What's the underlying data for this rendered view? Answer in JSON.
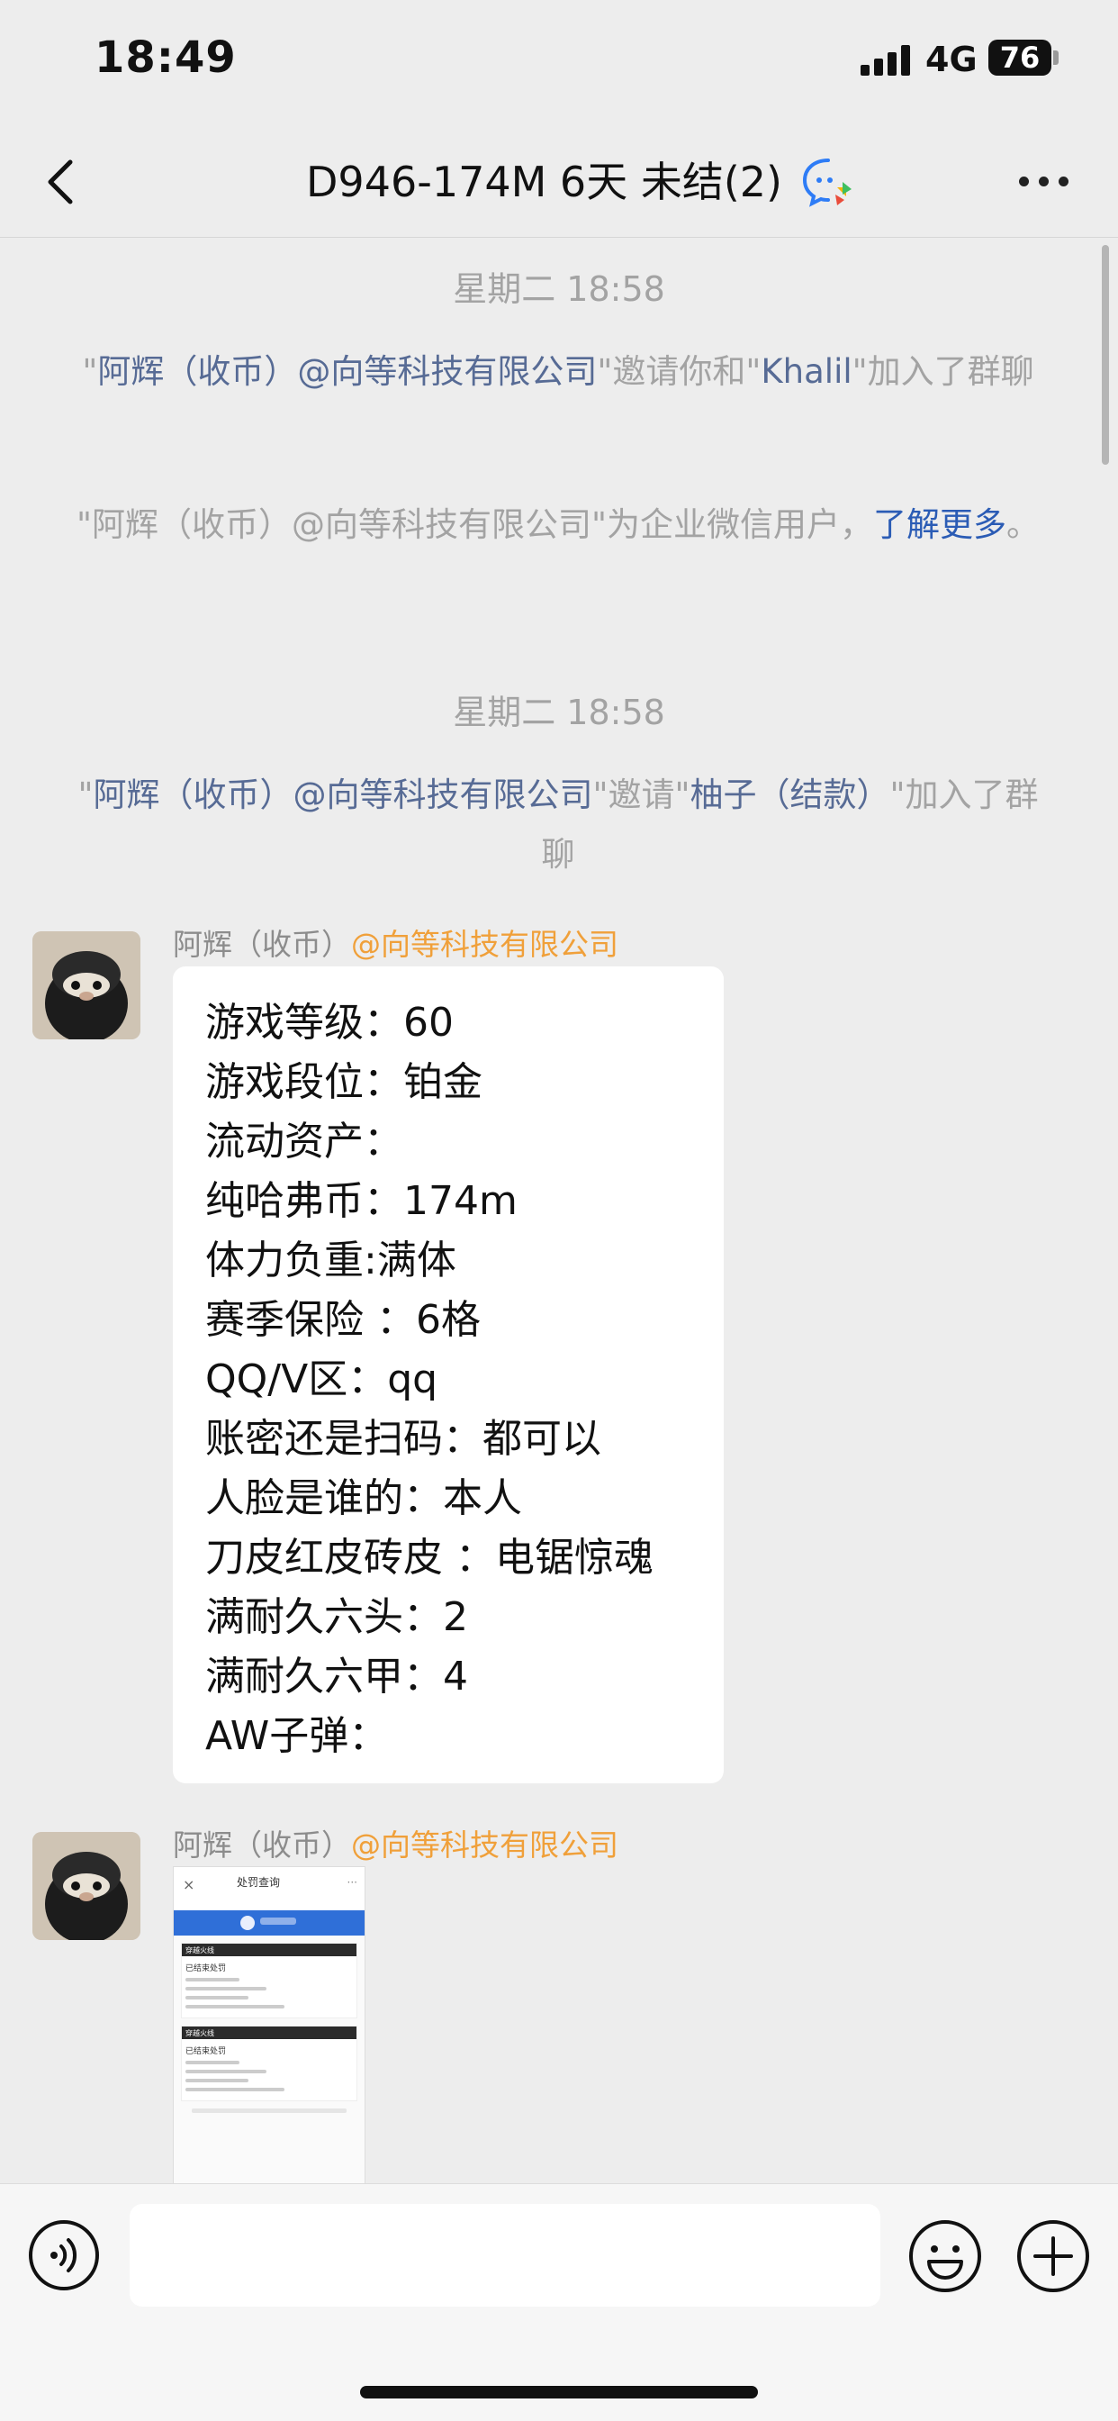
{
  "status_bar": {
    "time": "18:49",
    "network": "4G",
    "battery": "76"
  },
  "nav": {
    "title": "D946-174M 6天 未结(2)"
  },
  "system_messages": [
    {
      "time": "星期二 18:58"
    },
    {
      "q1": "\"",
      "inviter": "阿辉（收币）@向等科技有限公司",
      "mid": "\"邀请你和\"",
      "invitee": "Khalil",
      "tail": "\"加入了群聊"
    },
    {
      "q1": "\"阿辉（收币）@向等科技有限公司\"为企业微信用户，",
      "link": "了解更多",
      "tail": "。"
    },
    {
      "time": "星期二 18:58"
    },
    {
      "q1": "\"",
      "inviter": "阿辉（收币）@向等科技有限公司",
      "mid": "\"邀请\"",
      "invitee": "柚子（结款）",
      "tail": "\"加入了群聊"
    }
  ],
  "messages": [
    {
      "sender_name": "阿辉（收币）",
      "sender_org": "@向等科技有限公司",
      "lines": [
        "游戏等级：60",
        "游戏段位：铂金",
        "流动资产：",
        "纯哈弗币：174m",
        "体力负重:满体",
        "赛季保险 ：6格",
        "QQ/V区：qq",
        "账密还是扫码：都可以",
        "人脸是谁的：本人",
        "刀皮红皮砖皮 ：电锯惊魂",
        "满耐久六头：2",
        "满耐久六甲：4",
        "AW子弹："
      ]
    },
    {
      "sender_name": "阿辉（收币）",
      "sender_org": "@向等科技有限公司",
      "image": {
        "title": "处罚查询",
        "card1_caption": "穿越火线",
        "card1_text": "已结束处罚",
        "card2_caption": "穿越火线",
        "card2_text": "已结束处罚"
      }
    }
  ],
  "input": {
    "value": ""
  },
  "colors": {
    "link": "#576b95",
    "org": "#f0a03a",
    "background": "#ededed"
  }
}
